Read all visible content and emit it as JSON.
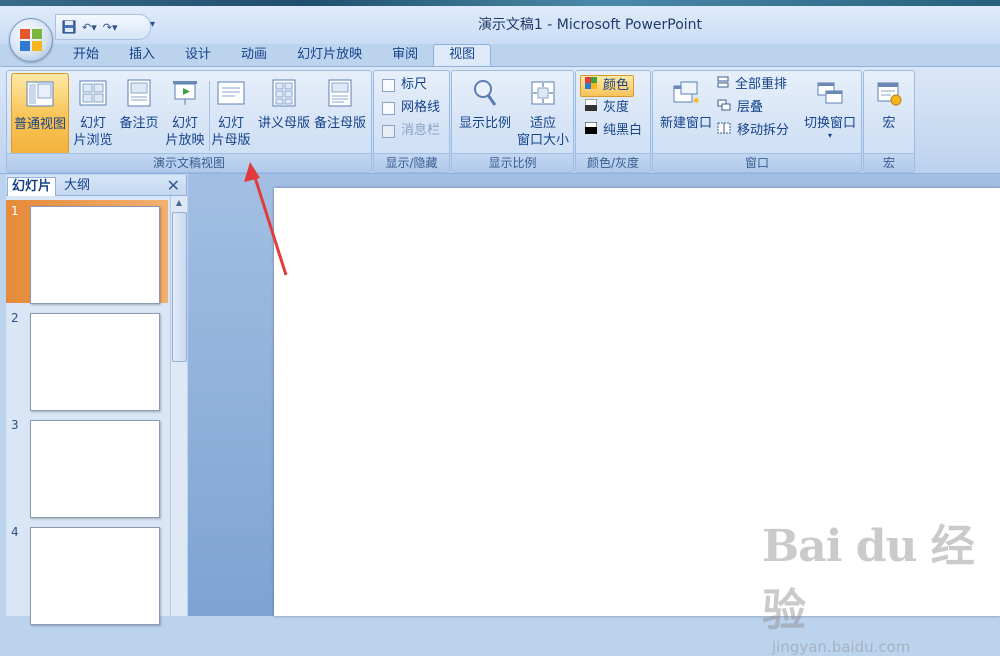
{
  "window": {
    "title": "演示文稿1 - Microsoft PowerPoint"
  },
  "tabs": [
    "开始",
    "插入",
    "设计",
    "动画",
    "幻灯片放映",
    "审阅",
    "视图"
  ],
  "active_tab": "视图",
  "ribbon": {
    "presentation_views": {
      "label": "演示文稿视图",
      "normal": "普通视图",
      "sorter_1": "幻灯",
      "sorter_2": "片浏览",
      "notes": "备注页",
      "slideshow_1": "幻灯",
      "slideshow_2": "片放映",
      "master_1": "幻灯",
      "master_2": "片母版",
      "handout_master": "讲义母版",
      "notes_master": "备注母版"
    },
    "show_hide": {
      "label": "显示/隐藏",
      "ruler": "标尺",
      "gridlines": "网格线",
      "message_bar": "消息栏"
    },
    "zoom": {
      "label": "显示比例",
      "zoom": "显示比例",
      "fit_1": "适应",
      "fit_2": "窗口大小"
    },
    "color": {
      "label": "颜色/灰度",
      "color": "颜色",
      "grayscale": "灰度",
      "bw": "纯黑白"
    },
    "window": {
      "label": "窗口",
      "new_window": "新建窗口",
      "arrange_all": "全部重排",
      "cascade": "层叠",
      "move_split": "移动拆分",
      "switch_windows": "切换窗口"
    },
    "macros": {
      "label": "宏",
      "macros": "宏"
    }
  },
  "left_pane": {
    "tab_slides": "幻灯片",
    "tab_outline": "大纲",
    "close": "✕",
    "slides": [
      {
        "num": "1",
        "selected": true
      },
      {
        "num": "2",
        "selected": false
      },
      {
        "num": "3",
        "selected": false
      },
      {
        "num": "4",
        "selected": false
      }
    ]
  },
  "watermark": {
    "main": "Bai du 经验",
    "sub": "jingyan.baidu.com"
  },
  "colors": {
    "accent": "#f5b23a",
    "ribbon": "#c6d9f1",
    "workspace": "#8fb0da",
    "annotation_arrow": "#e23b3b"
  }
}
